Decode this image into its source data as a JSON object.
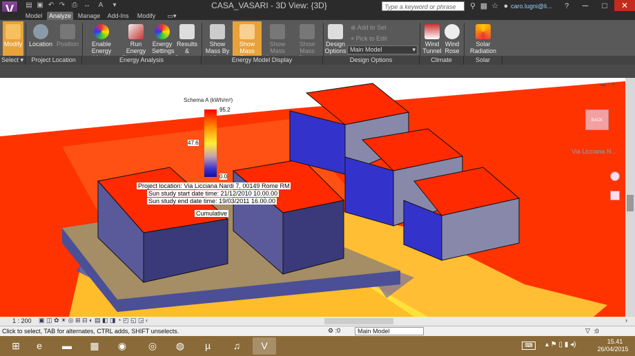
{
  "window": {
    "title": "CASA_VASARI - 3D View: {3D}",
    "search_placeholder": "Type a keyword or phrase",
    "user": "caro.lugni@li..."
  },
  "tabs": [
    "Model",
    "Analyze",
    "Manage",
    "Add-Ins",
    "Modify"
  ],
  "active_tab": "Analyze",
  "ribbon": {
    "buttons": {
      "modify": "Modify",
      "location": "Location",
      "position": "Position",
      "enable_energy": "Enable Energy Model",
      "run_energy": "Run Energy Simulation",
      "energy_settings": "Energy Settings",
      "results_compare": "Results & Compare",
      "show_mass_by_view": "Show Mass By View",
      "show_mass_form": "Show Mass Form",
      "show_mass_surfaces": "Show Mass Surfaces",
      "show_mass_zones": "Show Mass Zones",
      "design_options": "Design Options",
      "add_to_set": "Add to Set",
      "pick_to_edit": "Pick to Edit",
      "design_option_value": "Main Model",
      "wind_tunnel": "Wind Tunnel",
      "wind_rose": "Wind Rose",
      "solar_radiation": "Solar Radiation"
    },
    "panels": {
      "select": "Select ▾",
      "project_location": "Project Location",
      "energy_analysis": "Energy Analysis",
      "energy_model_display": "Energy Model Display",
      "design_options": "Design Options",
      "climate_analysis": "Climate Analysis",
      "solar_analysis": "Solar Analysis"
    }
  },
  "viewport": {
    "legend_title": "Schema A (kWh/m²)",
    "legend_max": "95.2",
    "legend_mid": "47.6",
    "legend_min": "0.0",
    "project_location": "Project location: Via Licciana Nardi 7, 00149 Rome RM",
    "sun_start": "Sun study start date time: 21/12/2010 10.00.00",
    "sun_end": "Sun study end date time: 19/03/2011 16.00.00",
    "mode": "Cumulative",
    "viewcube_label": "BACK",
    "view_label": "Via Licciana N..."
  },
  "view_bar": {
    "scale": "1 : 200"
  },
  "status_bar": {
    "message": "Click to select, TAB for alternates, CTRL adds, SHIFT unselects.",
    "design_option": "Main Model",
    "filter_count": ":0"
  },
  "taskbar": {
    "time": "15.41",
    "date": "26/04/2015"
  },
  "colors": {
    "heat_high": "#ff3300",
    "heat_mid": "#ffee33",
    "heat_low": "#1a1aa8",
    "building_side": "#5555a0",
    "ribbon_active": "#e8a23a"
  }
}
